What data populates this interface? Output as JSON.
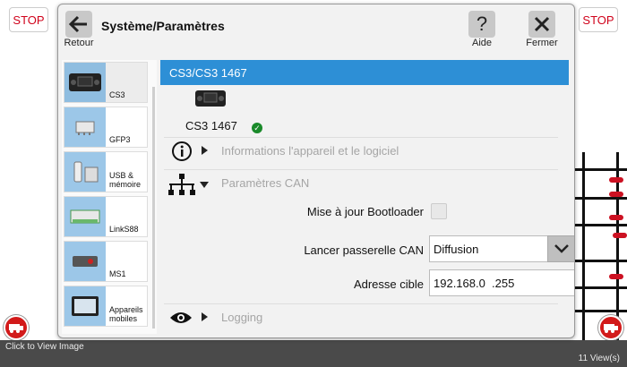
{
  "stop_left": "STOP",
  "stop_right": "STOP",
  "dialog": {
    "title": "Système/Paramètres",
    "back_label": "Retour",
    "help_label": "Aide",
    "close_label": "Fermer"
  },
  "sidebar": {
    "items": [
      {
        "label": "CS3"
      },
      {
        "label": "GFP3"
      },
      {
        "label": "USB &\nmémoire"
      },
      {
        "label": "LinkS88"
      },
      {
        "label": "MS1"
      },
      {
        "label": "Appareils\nmobiles"
      }
    ]
  },
  "main": {
    "selected_device": "CS3/CS3 1467",
    "device_name": "CS3 1467",
    "sections": {
      "info": "Informations l'appareil et le logiciel",
      "can": "Paramètres CAN",
      "logging": "Logging"
    },
    "bootloader_label": "Mise à jour Bootloader",
    "gateway_label": "Lancer passerelle CAN",
    "gateway_value": "Diffusion",
    "target_label": "Adresse cible",
    "target_value": "192.168.0  .255"
  },
  "footer": {
    "click_to_view": "Click to View Image",
    "views": "11 View(s)"
  },
  "colors": {
    "accent": "#2d8fd6",
    "stop": "#d0021b",
    "ok": "#1a8a2a",
    "warning": "#d0021b"
  }
}
